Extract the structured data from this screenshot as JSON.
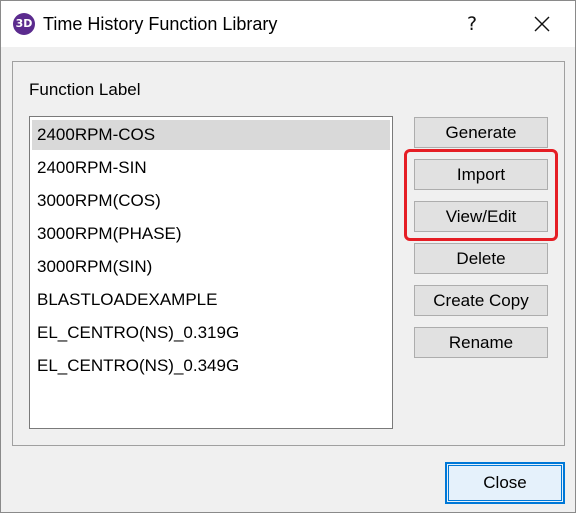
{
  "window": {
    "app_icon_text": "3D",
    "title": "Time History Function Library",
    "help_label": "?",
    "close_icon": "close-icon"
  },
  "group": {
    "label": "Function Label"
  },
  "functions": [
    {
      "label": "2400RPM-COS",
      "selected": true
    },
    {
      "label": "2400RPM-SIN",
      "selected": false
    },
    {
      "label": "3000RPM(COS)",
      "selected": false
    },
    {
      "label": "3000RPM(PHASE)",
      "selected": false
    },
    {
      "label": "3000RPM(SIN)",
      "selected": false
    },
    {
      "label": "BLASTLOADEXAMPLE",
      "selected": false
    },
    {
      "label": "EL_CENTRO(NS)_0.319G",
      "selected": false
    },
    {
      "label": "EL_CENTRO(NS)_0.349G",
      "selected": false
    }
  ],
  "buttons": {
    "generate": "Generate",
    "import": "Import",
    "view_edit": "View/Edit",
    "delete": "Delete",
    "create_copy": "Create Copy",
    "rename": "Rename",
    "close": "Close"
  },
  "colors": {
    "highlight": "#e51e25",
    "default_button_border": "#0078d7",
    "selection": "#d9d9d9",
    "app_icon": "#5b2b8e"
  }
}
